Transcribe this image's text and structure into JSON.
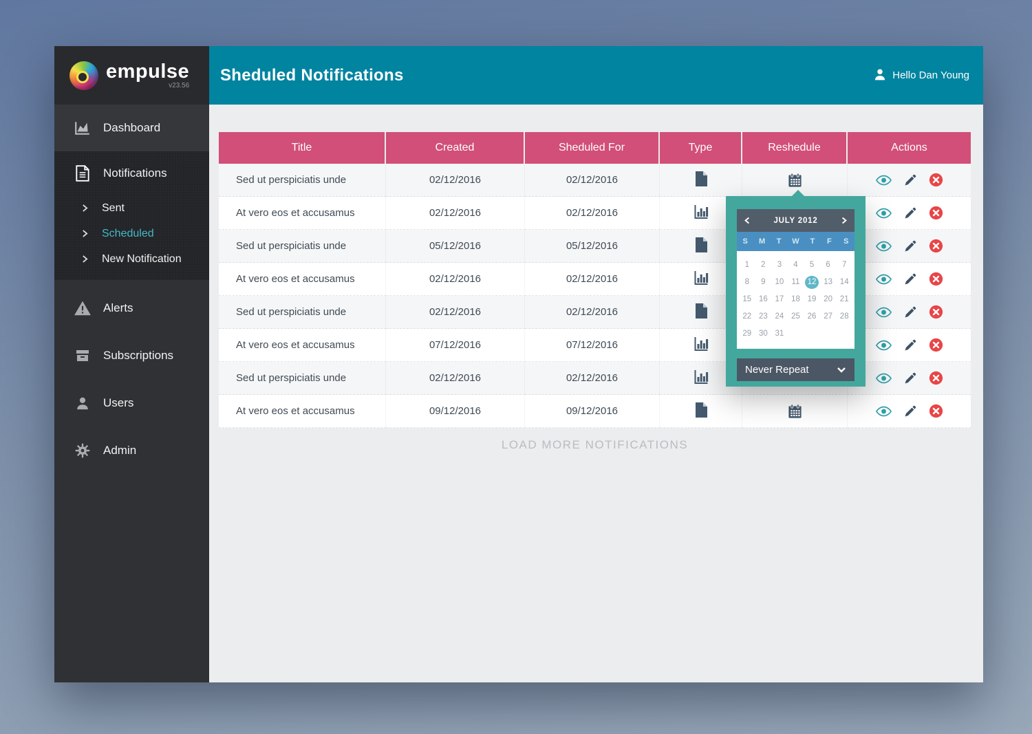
{
  "app": {
    "brand": "empulse",
    "version": "v23.56"
  },
  "header": {
    "title": "Sheduled Notifications",
    "user_greeting": "Hello Dan Young"
  },
  "sidebar": {
    "dashboard": "Dashboard",
    "notifications": "Notifications",
    "sub_items": [
      {
        "label": "Sent",
        "active": false
      },
      {
        "label": "Scheduled",
        "active": true
      },
      {
        "label": "New Notification",
        "active": false
      }
    ],
    "alerts": "Alerts",
    "subscriptions": "Subscriptions",
    "users": "Users",
    "admin": "Admin"
  },
  "table": {
    "columns": [
      "Title",
      "Created",
      "Sheduled For",
      "Type",
      "Reshedule",
      "Actions"
    ],
    "rows": [
      {
        "title": "Sed ut perspiciatis unde",
        "created": "02/12/2016",
        "scheduled_for": "02/12/2016",
        "type": "file"
      },
      {
        "title": "At vero eos et accusamus",
        "created": "02/12/2016",
        "scheduled_for": "02/12/2016",
        "type": "chart"
      },
      {
        "title": "Sed ut perspiciatis unde",
        "created": "05/12/2016",
        "scheduled_for": "05/12/2016",
        "type": "file"
      },
      {
        "title": "At vero eos et accusamus",
        "created": "02/12/2016",
        "scheduled_for": "02/12/2016",
        "type": "chart"
      },
      {
        "title": "Sed ut perspiciatis unde",
        "created": "02/12/2016",
        "scheduled_for": "02/12/2016",
        "type": "file"
      },
      {
        "title": "At vero eos et accusamus",
        "created": "07/12/2016",
        "scheduled_for": "07/12/2016",
        "type": "chart"
      },
      {
        "title": "Sed ut perspiciatis unde",
        "created": "02/12/2016",
        "scheduled_for": "02/12/2016",
        "type": "chart"
      },
      {
        "title": "At vero eos et accusamus",
        "created": "09/12/2016",
        "scheduled_for": "09/12/2016",
        "type": "file"
      }
    ],
    "load_more": "LOAD MORE NOTIFICATIONS"
  },
  "calendar": {
    "month_label": "JULY 2012",
    "day_headers": [
      "S",
      "M",
      "T",
      "W",
      "T",
      "F",
      "S"
    ],
    "days": [
      1,
      2,
      3,
      4,
      5,
      6,
      7,
      8,
      9,
      10,
      11,
      12,
      13,
      14,
      15,
      16,
      17,
      18,
      19,
      20,
      21,
      22,
      23,
      24,
      25,
      26,
      27,
      28,
      29,
      30,
      31
    ],
    "selected_day": 12,
    "repeat_label": "Never Repeat"
  },
  "colors": {
    "topbar_teal": "#0084a0",
    "table_header_pink": "#d14f78",
    "popup_teal": "#43a79e",
    "selected_day_teal": "#5fb7c8",
    "active_nav_teal": "#45b8c9",
    "delete_red": "#e84547"
  }
}
